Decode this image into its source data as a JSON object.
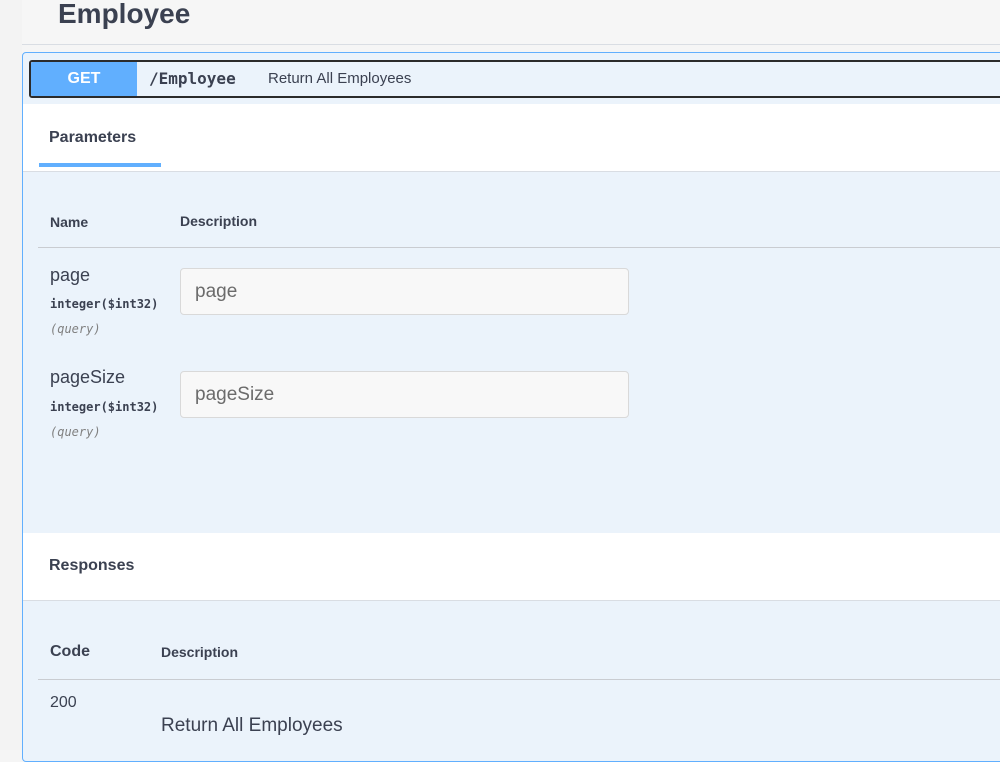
{
  "tag": {
    "name": "Employee"
  },
  "operation": {
    "method": "GET",
    "path": "/Employee",
    "summary": "Return All Employees",
    "method_color": "#61affe"
  },
  "parameters": {
    "tab_label": "Parameters",
    "columns": {
      "name": "Name",
      "description": "Description"
    },
    "items": [
      {
        "name": "page",
        "type": "integer",
        "format": "($int32)",
        "location": "(query)",
        "placeholder": "page",
        "value": ""
      },
      {
        "name": "pageSize",
        "type": "integer",
        "format": "($int32)",
        "location": "(query)",
        "placeholder": "pageSize",
        "value": ""
      }
    ]
  },
  "responses": {
    "header": "Responses",
    "columns": {
      "code": "Code",
      "description": "Description"
    },
    "items": [
      {
        "code": "200",
        "description": "Return All Employees"
      }
    ]
  }
}
